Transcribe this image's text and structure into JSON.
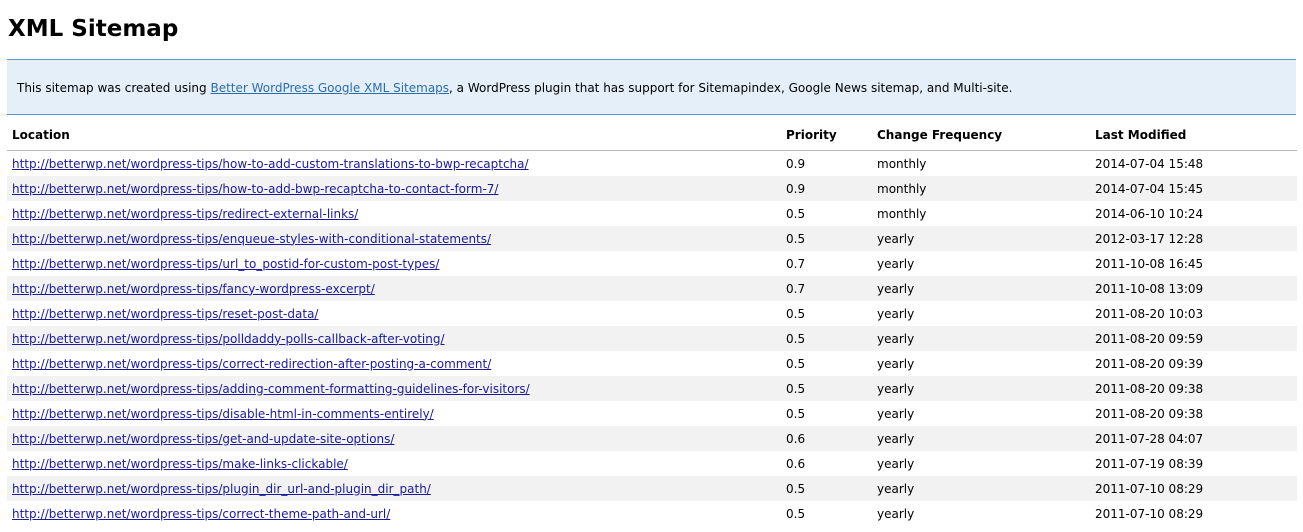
{
  "page_title": "XML Sitemap",
  "intro": {
    "before": "This sitemap was created using ",
    "link_text": "Better WordPress Google XML Sitemaps",
    "after": ", a WordPress plugin that has support for Sitemapindex, Google News sitemap, and Multi-site."
  },
  "table": {
    "headers": {
      "location": "Location",
      "priority": "Priority",
      "change_frequency": "Change Frequency",
      "last_modified": "Last Modified"
    },
    "rows": [
      {
        "url": "http://betterwp.net/wordpress-tips/how-to-add-custom-translations-to-bwp-recaptcha/",
        "priority": "0.9",
        "frequency": "monthly",
        "modified": "2014-07-04 15:48"
      },
      {
        "url": "http://betterwp.net/wordpress-tips/how-to-add-bwp-recaptcha-to-contact-form-7/",
        "priority": "0.9",
        "frequency": "monthly",
        "modified": "2014-07-04 15:45"
      },
      {
        "url": "http://betterwp.net/wordpress-tips/redirect-external-links/",
        "priority": "0.5",
        "frequency": "monthly",
        "modified": "2014-06-10 10:24"
      },
      {
        "url": "http://betterwp.net/wordpress-tips/enqueue-styles-with-conditional-statements/",
        "priority": "0.5",
        "frequency": "yearly",
        "modified": "2012-03-17 12:28"
      },
      {
        "url": "http://betterwp.net/wordpress-tips/url_to_postid-for-custom-post-types/",
        "priority": "0.7",
        "frequency": "yearly",
        "modified": "2011-10-08 16:45"
      },
      {
        "url": "http://betterwp.net/wordpress-tips/fancy-wordpress-excerpt/",
        "priority": "0.7",
        "frequency": "yearly",
        "modified": "2011-10-08 13:09"
      },
      {
        "url": "http://betterwp.net/wordpress-tips/reset-post-data/",
        "priority": "0.5",
        "frequency": "yearly",
        "modified": "2011-08-20 10:03"
      },
      {
        "url": "http://betterwp.net/wordpress-tips/polldaddy-polls-callback-after-voting/",
        "priority": "0.5",
        "frequency": "yearly",
        "modified": "2011-08-20 09:59"
      },
      {
        "url": "http://betterwp.net/wordpress-tips/correct-redirection-after-posting-a-comment/",
        "priority": "0.5",
        "frequency": "yearly",
        "modified": "2011-08-20 09:39"
      },
      {
        "url": "http://betterwp.net/wordpress-tips/adding-comment-formatting-guidelines-for-visitors/",
        "priority": "0.5",
        "frequency": "yearly",
        "modified": "2011-08-20 09:38"
      },
      {
        "url": "http://betterwp.net/wordpress-tips/disable-html-in-comments-entirely/",
        "priority": "0.5",
        "frequency": "yearly",
        "modified": "2011-08-20 09:38"
      },
      {
        "url": "http://betterwp.net/wordpress-tips/get-and-update-site-options/",
        "priority": "0.6",
        "frequency": "yearly",
        "modified": "2011-07-28 04:07"
      },
      {
        "url": "http://betterwp.net/wordpress-tips/make-links-clickable/",
        "priority": "0.6",
        "frequency": "yearly",
        "modified": "2011-07-19 08:39"
      },
      {
        "url": "http://betterwp.net/wordpress-tips/plugin_dir_url-and-plugin_dir_path/",
        "priority": "0.5",
        "frequency": "yearly",
        "modified": "2011-07-10 08:29"
      },
      {
        "url": "http://betterwp.net/wordpress-tips/correct-theme-path-and-url/",
        "priority": "0.5",
        "frequency": "yearly",
        "modified": "2011-07-10 08:29"
      }
    ]
  },
  "colors": {
    "intro_background": "#e5eff9",
    "intro_border": "#5b97c8",
    "intro_link": "#2a6dad",
    "row_link": "#1a1a9e",
    "stripe": "#f2f2f2"
  }
}
